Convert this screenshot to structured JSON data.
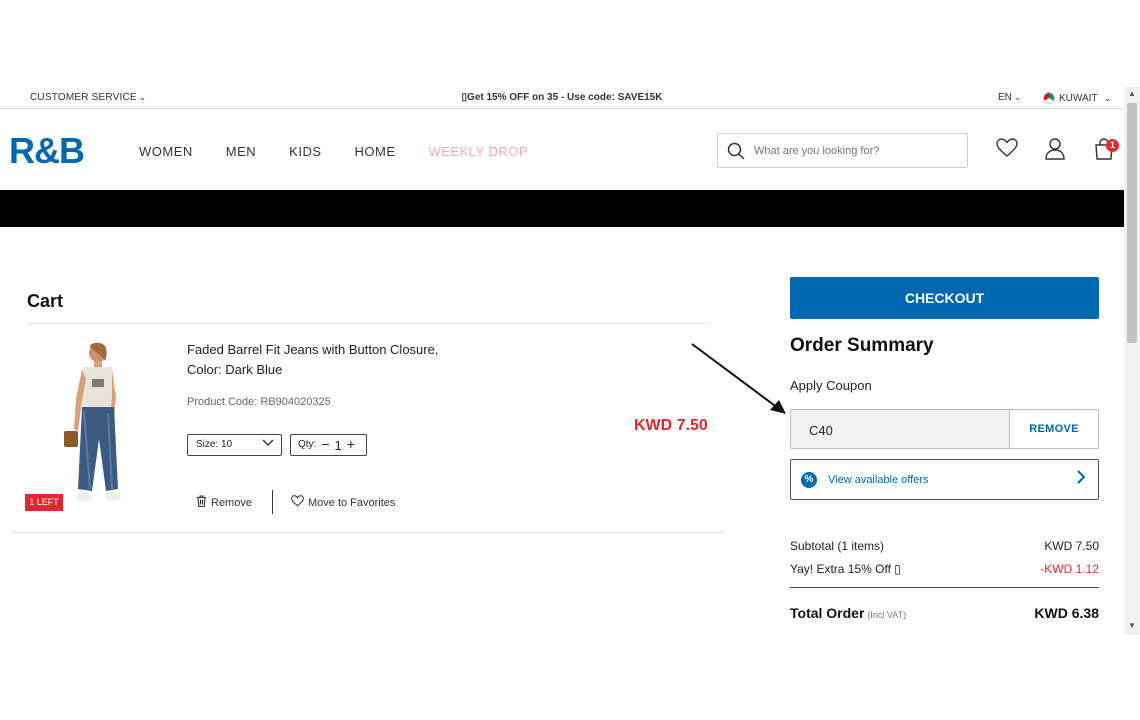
{
  "topbar": {
    "customer_service": "CUSTOMER SERVICE",
    "promo": "▯Get 15% OFF on 35 - Use code: SAVE15K",
    "language": "EN",
    "country": "KUWAIT"
  },
  "header": {
    "logo": "R&B",
    "nav": [
      "WOMEN",
      "MEN",
      "KIDS",
      "HOME",
      "WEEKLY DROP"
    ],
    "search_placeholder": "What are you looking for?",
    "cart_count": "1"
  },
  "cart": {
    "title": "Cart",
    "item": {
      "name_line1": "Faded Barrel Fit Jeans with Button Closure,",
      "name_line2": "Color: Dark Blue",
      "product_code": "Product Code: RB904020325",
      "size": "Size: 10",
      "qty_label": "Qty:",
      "qty_minus": "−",
      "qty_value": "1",
      "qty_plus": "+",
      "price": "KWD 7.50",
      "stock_badge": "1 LEFT",
      "remove_label": "Remove",
      "favorite_label": "Move to Favorites"
    }
  },
  "summary": {
    "checkout_label": "CHECKOUT",
    "title": "Order Summary",
    "apply_coupon_label": "Apply Coupon",
    "coupon_value": "C40",
    "coupon_remove_label": "REMOVE",
    "offers_label": "View available offers",
    "subtotal_label": "Subtotal (1 items)",
    "subtotal_value": "KWD 7.50",
    "discount_label": "Yay! Extra 15% Off ▯",
    "discount_value": "-KWD 1.12",
    "total_label": "Total Order",
    "total_vat": "(Incl VAT)",
    "total_value": "KWD 6.38"
  },
  "colors": {
    "brand_blue": "#0067b1",
    "price_red": "#e3262f",
    "weekly_pink": "#f4a7b9"
  }
}
